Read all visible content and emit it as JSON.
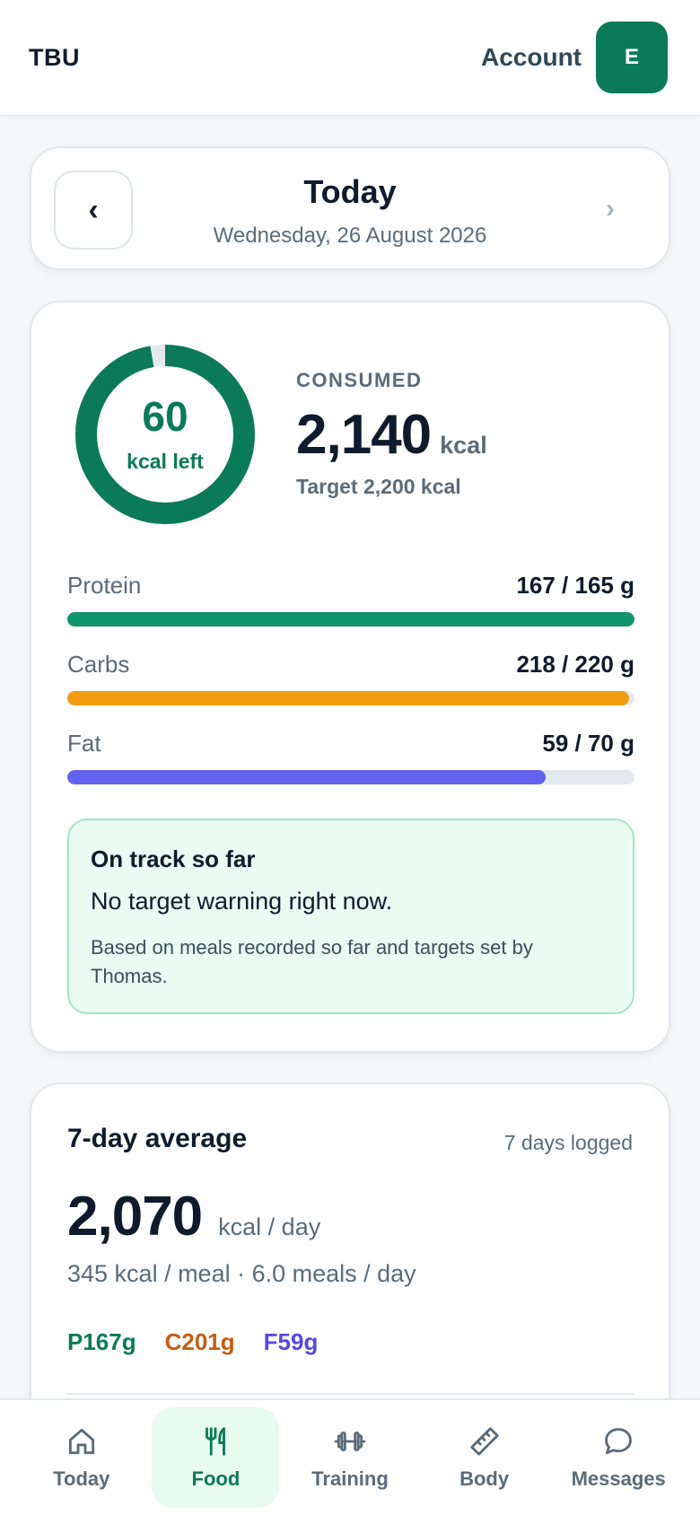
{
  "header": {
    "brand": "TBU",
    "account_label": "Account",
    "avatar_initial": "E"
  },
  "date_nav": {
    "title": "Today",
    "subtitle": "Wednesday, 26 August 2026",
    "prev_icon": "chevron-left-icon",
    "next_icon": "chevron-right-icon",
    "prev_glyph": "‹",
    "next_glyph": "›"
  },
  "summary": {
    "ring_value": "60",
    "ring_label": "kcal left",
    "ring_fraction_consumed": 0.973,
    "consumed_label": "CONSUMED",
    "consumed_value": "2,140",
    "consumed_unit": "kcal",
    "target_text": "Target 2,200 kcal",
    "macros": [
      {
        "name": "Protein",
        "value_text": "167 / 165 g",
        "fraction": 1.0,
        "color": "#11956a"
      },
      {
        "name": "Carbs",
        "value_text": "218 / 220 g",
        "fraction": 0.99,
        "color": "#f19d11"
      },
      {
        "name": "Fat",
        "value_text": "59 / 70 g",
        "fraction": 0.843,
        "color": "#6362ee"
      }
    ],
    "notice": {
      "title": "On track so far",
      "text": "No target warning right now.",
      "footnote": "Based on meals recorded so far and targets set by Thomas."
    }
  },
  "average": {
    "title": "7-day average",
    "days_logged": "7 days logged",
    "value": "2,070",
    "unit": "kcal / day",
    "meta": "345 kcal / meal · 6.0 meals / day",
    "protein": "P167g",
    "carbs": "C201g",
    "fat": "F59g",
    "colors": {
      "protein": "#0b7a57",
      "carbs": "#c25f10",
      "fat": "#5848e5"
    }
  },
  "nav": {
    "items": [
      {
        "label": "Today",
        "icon": "home-icon",
        "active": false
      },
      {
        "label": "Food",
        "icon": "fork-knife-icon",
        "active": true
      },
      {
        "label": "Training",
        "icon": "dumbbell-icon",
        "active": false
      },
      {
        "label": "Body",
        "icon": "ruler-icon",
        "active": false
      },
      {
        "label": "Messages",
        "icon": "chat-bubble-icon",
        "active": false
      }
    ]
  },
  "colors": {
    "brand_green": "#0b7a57",
    "ring_track": "#e5e9ee",
    "notice_bg": "#ebfbf3",
    "notice_border": "#9fe6c6"
  }
}
